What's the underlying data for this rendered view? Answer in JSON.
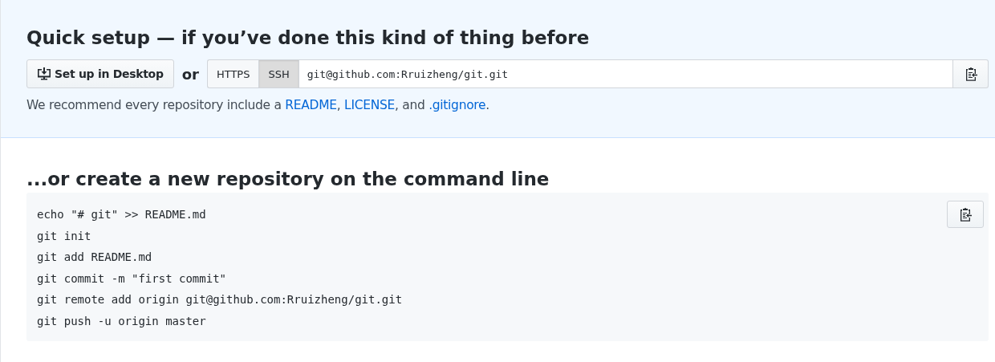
{
  "quick_setup": {
    "title": "Quick setup — if you’ve done this kind of thing before",
    "desktop_button": "Set up in Desktop",
    "or": "or",
    "protocols": [
      {
        "label": "HTTPS",
        "selected": false
      },
      {
        "label": "SSH",
        "selected": true
      }
    ],
    "clone_url": "git@github.com:Rruizheng/git.git",
    "recommend": [
      {
        "kind": "plain",
        "text": "We recommend every repository include a "
      },
      {
        "kind": "link",
        "text": "README"
      },
      {
        "kind": "plain",
        "text": ", "
      },
      {
        "kind": "link",
        "text": "LICENSE"
      },
      {
        "kind": "plain",
        "text": ", and "
      },
      {
        "kind": "link",
        "text": ".gitignore"
      },
      {
        "kind": "plain",
        "text": "."
      }
    ]
  },
  "command_line": {
    "title": "...or create a new repository on the command line",
    "lines": [
      "echo \"# git\" >> README.md",
      "git init",
      "git add README.md",
      "git commit -m \"first commit\"",
      "git remote add origin git@github.com:Rruizheng/git.git",
      "git push -u origin master"
    ]
  }
}
